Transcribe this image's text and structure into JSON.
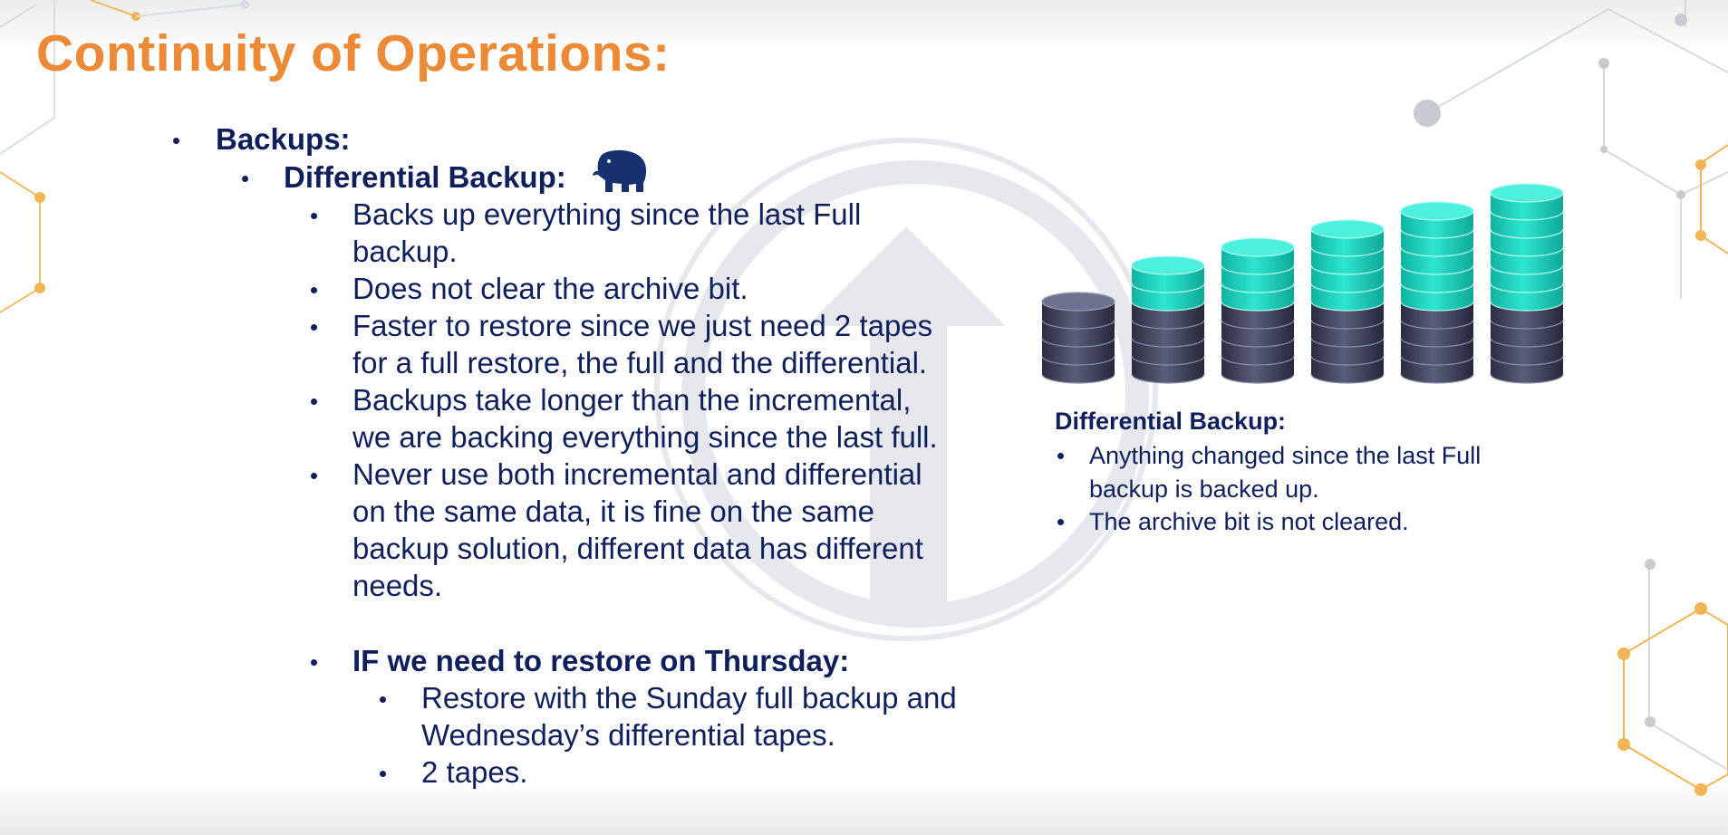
{
  "slide": {
    "title": "Continuity of Operations:"
  },
  "outline": {
    "level1": "Backups:",
    "level2": "Differential Backup:",
    "bullets": [
      [
        "Backs up everything since the last Full",
        "backup."
      ],
      [
        "Does not clear the archive bit."
      ],
      [
        "Faster to restore since we just need 2 tapes",
        "for a full restore, the full and the differential."
      ],
      [
        "Backups take longer than the incremental,",
        "we are backing everything since the last full."
      ],
      [
        "Never use both incremental and differential",
        "on the same data, it is fine on the same",
        "backup solution, different data has different",
        "needs."
      ]
    ],
    "scenario_heading": "IF we need to restore on Thursday:",
    "scenario_bullets": [
      [
        "Restore with the Sunday full backup and",
        "Wednesday’s differential tapes."
      ],
      [
        "2 tapes."
      ]
    ]
  },
  "illustration": {
    "icon": "elephant-icon",
    "stacks": [
      {
        "full_disks": 4,
        "differential_disks": 0
      },
      {
        "full_disks": 4,
        "differential_disks": 2
      },
      {
        "full_disks": 4,
        "differential_disks": 3
      },
      {
        "full_disks": 4,
        "differential_disks": 4
      },
      {
        "full_disks": 4,
        "differential_disks": 5
      },
      {
        "full_disks": 4,
        "differential_disks": 6
      }
    ],
    "colors": {
      "full": "#3a3d55",
      "differential": "#17cdb8"
    }
  },
  "side_panel": {
    "heading": "Differential Backup:",
    "bullets": [
      [
        "Anything changed since the last Full",
        "backup is backed up."
      ],
      [
        "The archive bit is not cleared."
      ]
    ]
  },
  "colors": {
    "title": "#ec8a37",
    "text": "#0f1f5c",
    "accent_nodes": "#f2b457"
  }
}
